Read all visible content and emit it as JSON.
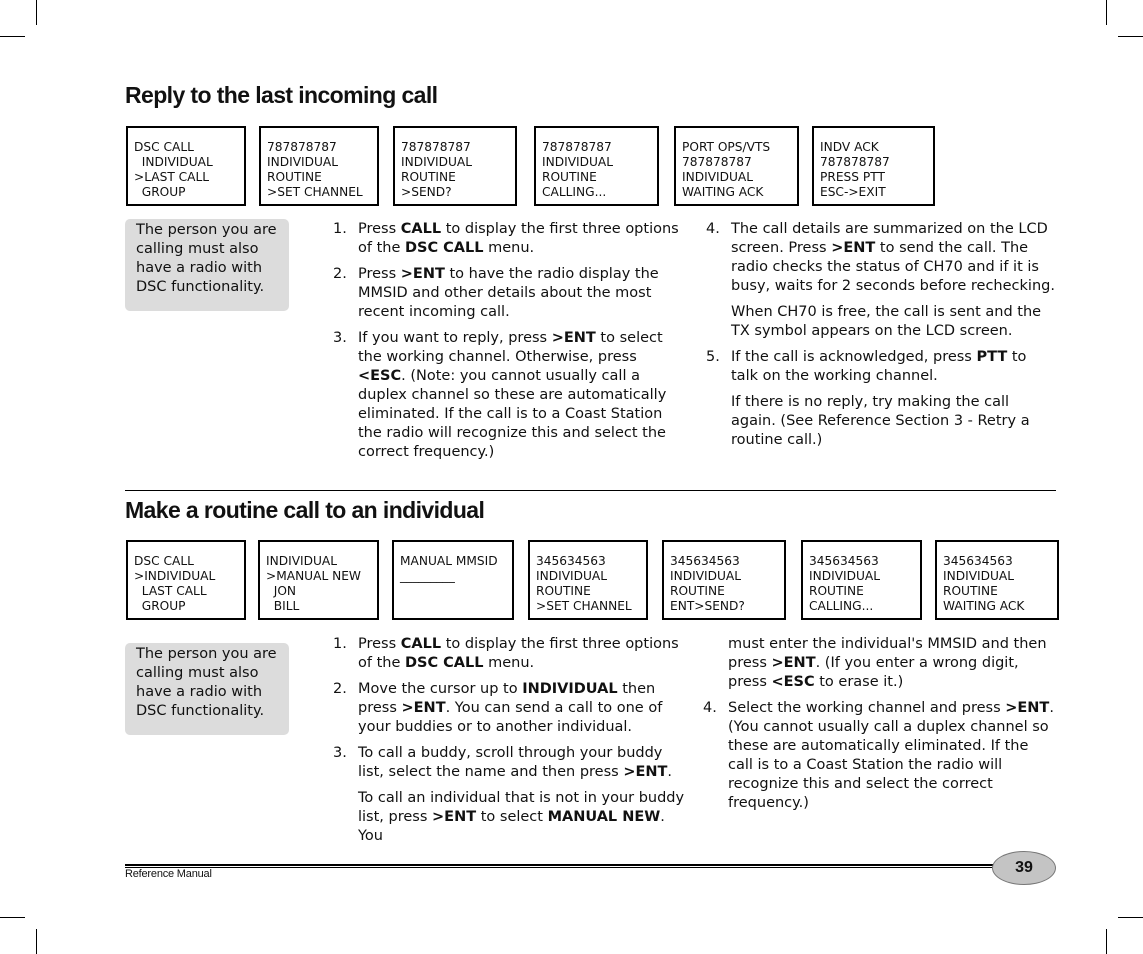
{
  "section1": {
    "title": "Reply to the last incoming call",
    "screens": [
      "DSC CALL\n  INDIVIDUAL\n>LAST CALL\n  GROUP",
      "787878787\nINDIVIDUAL\nROUTINE\n>SET CHANNEL",
      "787878787\nINDIVIDUAL\nROUTINE\n>SEND?",
      "787878787\nINDIVIDUAL\nROUTINE\nCALLING...",
      "PORT OPS/VTS\n787878787\nINDIVIDUAL\nWAITING ACK",
      "INDV ACK\n787878787\nPRESS PTT\nESC->EXIT"
    ],
    "note": "The person you are calling must also have a radio with DSC functionality.",
    "steps": {
      "s1": {
        "num": "1.",
        "a": "Press ",
        "b1": "CALL",
        "c": " to display the first three options of the ",
        "b2": "DSC CALL",
        "d": " menu."
      },
      "s2": {
        "num": "2.",
        "a": "Press ",
        "b1": ">ENT",
        "c": " to have the radio display the MMSID and other details about the most recent incoming call."
      },
      "s3": {
        "num": "3.",
        "a": "If you want to reply, press ",
        "b1": ">ENT",
        "c": " to select the working channel. Otherwise, press ",
        "b2": "<ESC",
        "d": ". (Note: you cannot usually call a duplex channel so these are automatically eliminated. If the call is to a Coast Station the radio will recognize this and select the correct frequency.)"
      },
      "s4": {
        "num": "4.",
        "a": "The call details are summarized on the LCD screen. Press ",
        "b1": ">ENT",
        "c": " to send the call. The radio checks the status of CH70 and if it is busy, waits for 2 seconds before rechecking."
      },
      "s4p": "When CH70 is free, the call is sent and the TX symbol appears on the LCD screen.",
      "s5": {
        "num": "5.",
        "a": "If the call is acknowledged, press ",
        "b1": "PTT",
        "c": " to talk on the working channel."
      },
      "s5p": "If there is no reply, try making the call again. (See Reference Section 3 - Retry a routine call.)"
    }
  },
  "section2": {
    "title": "Make a routine call to an individual",
    "screens": [
      "DSC CALL\n>INDIVIDUAL\n  LAST CALL\n  GROUP",
      "INDIVIDUAL\n>MANUAL NEW\n  JON\n  BILL",
      "MANUAL MMSID\n_________",
      "345634563\nINDIVIDUAL\nROUTINE\n>SET CHANNEL",
      "345634563\nINDIVIDUAL\nROUTINE\nENT>SEND?",
      "345634563\nINDIVIDUAL\nROUTINE\nCALLING...",
      "345634563\nINDIVIDUAL\nROUTINE\nWAITING ACK"
    ],
    "note": "The person you are calling must also have a radio with DSC functionality.",
    "steps": {
      "s1": {
        "num": "1.",
        "a": "Press ",
        "b1": "CALL",
        "c": " to display the first three options of the ",
        "b2": "DSC CALL",
        "d": " menu."
      },
      "s2": {
        "num": "2.",
        "a": "Move the cursor up to ",
        "b1": "INDIVIDUAL",
        "c": " then press ",
        "b2": ">ENT",
        "d": ". You can send a call to one of your buddies or to another individual."
      },
      "s3": {
        "num": "3.",
        "a": "To call a buddy, scroll through your buddy list, select the name and then press ",
        "b1": ">ENT",
        "c": "."
      },
      "s3p": {
        "a": "To call an individual that is not in your buddy list, press ",
        "b1": ">ENT",
        "c": " to select ",
        "b2": "MANUAL NEW",
        "d": ". You"
      },
      "s3p_cont": {
        "a": "must enter the individual's MMSID and then press ",
        "b1": ">ENT",
        "c": ". (If you enter a wrong digit, press ",
        "b2": "<ESC",
        "d": " to erase it.)"
      },
      "s4": {
        "num": "4.",
        "a": "Select the working channel and press ",
        "b1": ">ENT",
        "c": ". (You cannot usually call a duplex channel so these are automatically eliminated. If the call is to a Coast Station the radio will recognize this and select the correct frequency.)"
      }
    }
  },
  "footer": {
    "label": "Reference Manual",
    "page_number": "39"
  }
}
